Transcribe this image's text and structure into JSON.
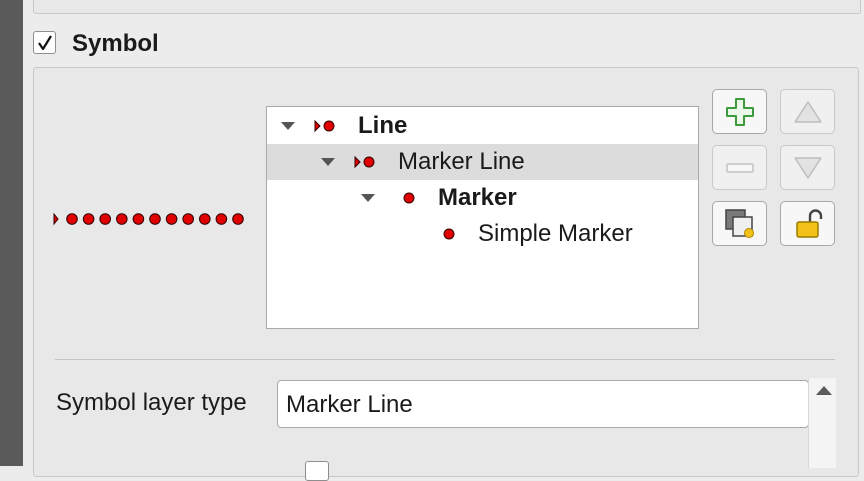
{
  "symbol_group": {
    "title": "Symbol",
    "checked": true
  },
  "layers_tree": [
    {
      "label": "Line",
      "bold": true,
      "expanded": true,
      "selected": false,
      "icon": "line-marker-icon"
    },
    {
      "label": "Marker Line",
      "bold": false,
      "expanded": true,
      "selected": true,
      "icon": "line-marker-icon"
    },
    {
      "label": "Marker",
      "bold": true,
      "expanded": true,
      "selected": false,
      "icon": "dot-marker-icon"
    },
    {
      "label": "Simple Marker",
      "bold": false,
      "expanded": false,
      "selected": false,
      "icon": "dot-marker-icon"
    }
  ],
  "toolbar": {
    "add_layer": {
      "icon": "plus-icon",
      "enabled": true
    },
    "remove_layer": {
      "icon": "minus-icon",
      "enabled": false
    },
    "move_up": {
      "icon": "arrow-up-icon",
      "enabled": false
    },
    "move_down": {
      "icon": "arrow-down-icon",
      "enabled": false
    },
    "duplicate_layer": {
      "icon": "duplicate-layer-icon",
      "enabled": true
    },
    "lock_layer": {
      "icon": "unlock-icon",
      "enabled": true
    }
  },
  "layer_type": {
    "label": "Symbol layer type",
    "value": "Marker Line"
  },
  "colors": {
    "marker_fill": "#e00000",
    "marker_outline": "#300000",
    "add_icon": "#3d9a3d",
    "lock_icon": "#f2c21a",
    "selection": "#dcdcdc"
  }
}
